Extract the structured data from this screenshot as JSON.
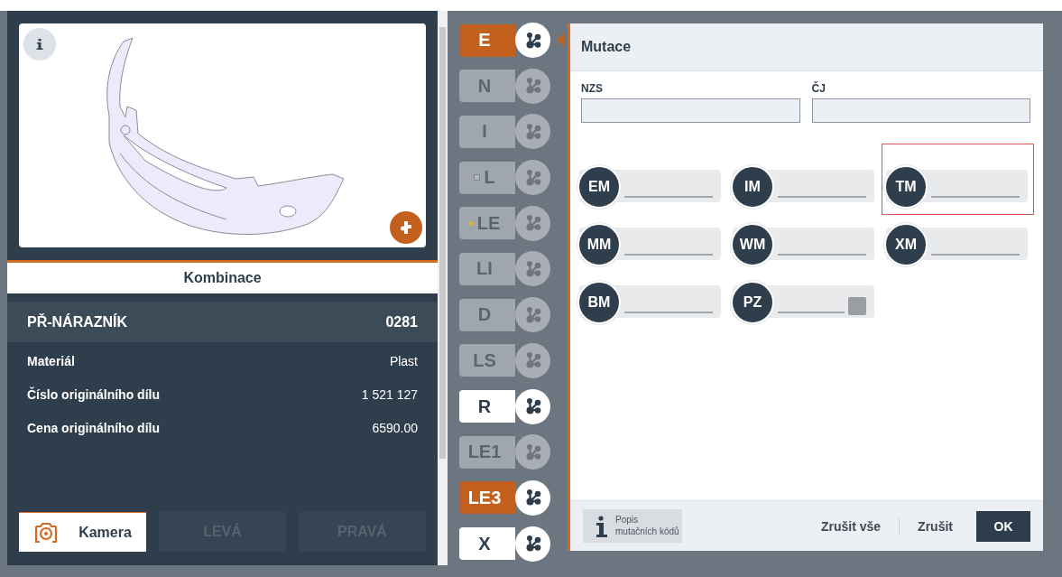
{
  "part_view": {
    "title": "Kombinace"
  },
  "part": {
    "name": "PŘ-NÁRAZNÍK",
    "code": "0281",
    "rows": [
      {
        "label": "Materiál",
        "value": "Plast"
      },
      {
        "label": "Číslo originálního dílu",
        "value": "1 521 127"
      },
      {
        "label": "Cena originálního dílu",
        "value": "6590.00"
      }
    ]
  },
  "bottom_buttons": [
    {
      "label": "Kamera",
      "disabled": false
    },
    {
      "label": "LEVÁ",
      "disabled": true
    },
    {
      "label": "PRAVÁ",
      "disabled": true
    }
  ],
  "positions": [
    {
      "label": "E",
      "kind": "plain",
      "highlighted": true,
      "disabled": false,
      "selected": true
    },
    {
      "label": "N",
      "kind": "plain",
      "highlighted": false,
      "disabled": true,
      "selected": false
    },
    {
      "label": "I",
      "kind": "plain",
      "highlighted": false,
      "disabled": true,
      "selected": false
    },
    {
      "label": "L",
      "kind": "square",
      "highlighted": false,
      "disabled": true,
      "selected": false
    },
    {
      "label": "LE",
      "kind": "dot",
      "highlighted": false,
      "disabled": true,
      "selected": false
    },
    {
      "label": "LI",
      "kind": "plain",
      "highlighted": false,
      "disabled": true,
      "selected": false
    },
    {
      "label": "D",
      "kind": "plain",
      "highlighted": false,
      "disabled": true,
      "selected": false
    },
    {
      "label": "LS",
      "kind": "plain",
      "highlighted": false,
      "disabled": true,
      "selected": false
    },
    {
      "label": "R",
      "kind": "plain",
      "highlighted": false,
      "disabled": false,
      "selected": false
    },
    {
      "label": "LE1",
      "kind": "plain",
      "highlighted": false,
      "disabled": true,
      "selected": false
    },
    {
      "label": "LE3",
      "kind": "plain",
      "highlighted": true,
      "disabled": false,
      "selected": false
    },
    {
      "label": "X",
      "kind": "plain",
      "highlighted": false,
      "disabled": false,
      "selected": false
    }
  ],
  "dialog": {
    "title": "Mutace",
    "fields": [
      {
        "label": "NZS"
      },
      {
        "label": "ČJ"
      }
    ],
    "codes": [
      {
        "code": "EM",
        "kind": "line",
        "highlighted": false
      },
      {
        "code": "IM",
        "kind": "line",
        "highlighted": false
      },
      {
        "code": "TM",
        "kind": "line",
        "highlighted": true
      },
      {
        "code": "MM",
        "kind": "line",
        "highlighted": false
      },
      {
        "code": "WM",
        "kind": "line",
        "highlighted": false
      },
      {
        "code": "XM",
        "kind": "line",
        "highlighted": false
      },
      {
        "code": "BM",
        "kind": "line",
        "highlighted": false
      },
      {
        "code": "PZ",
        "kind": "toggle",
        "highlighted": false
      }
    ],
    "info": "Popis mutačních kódů",
    "buttons": [
      {
        "label": "Zrušit vše",
        "kind": "text"
      },
      {
        "label": "Zrušit",
        "kind": "text"
      },
      {
        "label": "OK",
        "kind": "primary"
      }
    ]
  }
}
